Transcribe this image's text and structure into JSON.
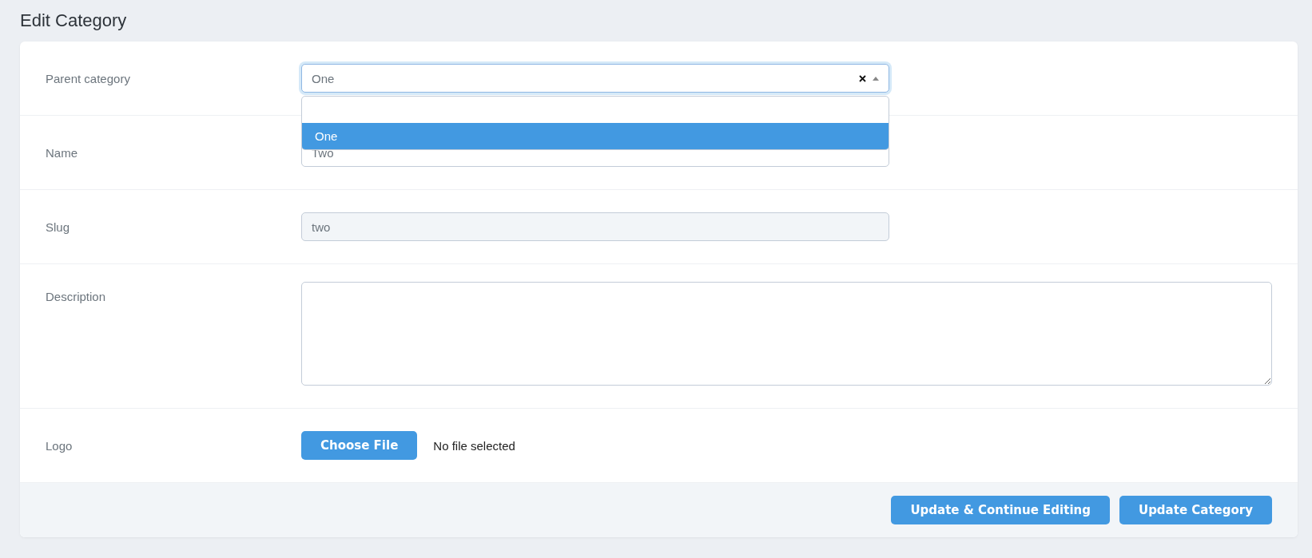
{
  "page_title": "Edit Category",
  "fields": [
    {
      "kind": "select",
      "label": "Parent category",
      "value": "One",
      "clearable": true,
      "open": true,
      "options": [
        {
          "label": "One",
          "selected": true
        }
      ]
    },
    {
      "kind": "text",
      "label": "Name",
      "value": "Two",
      "disabled": false
    },
    {
      "kind": "text",
      "label": "Slug",
      "value": "two",
      "disabled": true
    },
    {
      "kind": "textarea",
      "label": "Description"
    },
    {
      "kind": "file",
      "label": "Logo",
      "button": "Choose File",
      "status": "No file selected"
    }
  ],
  "actions": [
    "Update & Continue Editing",
    "Update Category"
  ]
}
